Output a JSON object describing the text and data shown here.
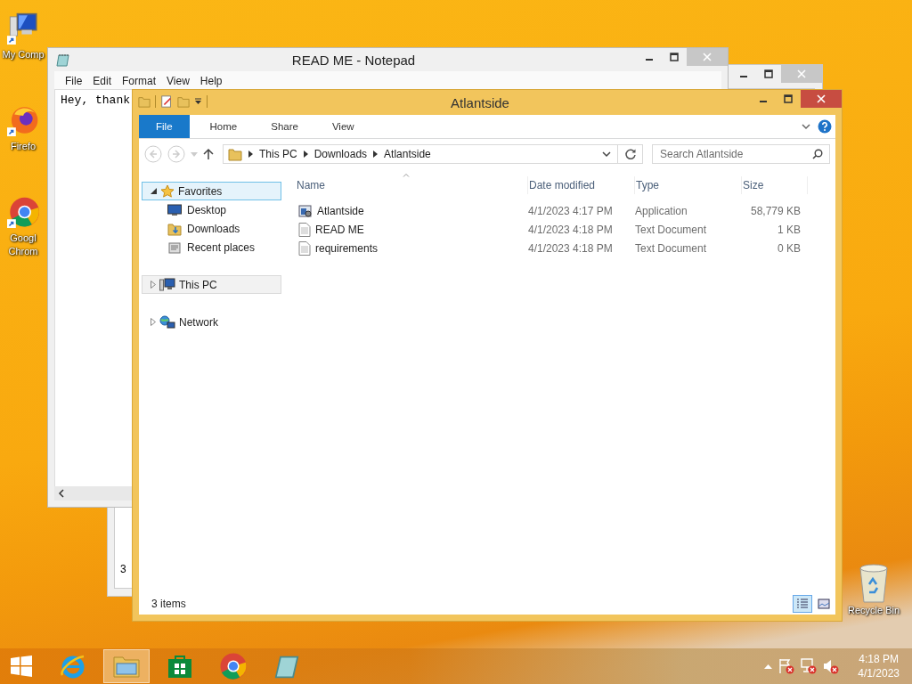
{
  "desktop_icons": [
    {
      "kind": "computer",
      "lines": [
        "My Comp"
      ]
    },
    {
      "kind": "firefox",
      "lines": [
        "Firefo"
      ]
    },
    {
      "kind": "chrome",
      "lines": [
        "Googl",
        "Chrom"
      ]
    }
  ],
  "recycle_bin": {
    "label": "Recycle Bin"
  },
  "background_window": {
    "text": "3"
  },
  "notepad": {
    "title": "READ ME - Notepad",
    "menu": [
      "File",
      "Edit",
      "Format",
      "View",
      "Help"
    ],
    "text": "Hey, thank"
  },
  "explorer": {
    "title": "Atlantside",
    "ribbon_tabs": [
      {
        "label": "File",
        "selected": true
      },
      {
        "label": "Home",
        "selected": false
      },
      {
        "label": "Share",
        "selected": false
      },
      {
        "label": "View",
        "selected": false
      }
    ],
    "breadcrumb": [
      "This PC",
      "Downloads",
      "Atlantside"
    ],
    "search": {
      "placeholder": "Search Atlantside"
    },
    "nav": [
      {
        "label": "Favorites",
        "kind": "favorites",
        "expanded": true,
        "selected": true,
        "focused": false,
        "children": [
          {
            "label": "Desktop",
            "kind": "desktop",
            "selected": false
          },
          {
            "label": "Downloads",
            "kind": "downloads",
            "selected": false
          },
          {
            "label": "Recent places",
            "kind": "recent",
            "selected": false
          }
        ]
      },
      {
        "label": "This PC",
        "kind": "pc",
        "expanded": false,
        "selected": false,
        "focused": true
      },
      {
        "label": "Network",
        "kind": "network",
        "expanded": false,
        "selected": false,
        "focused": false
      }
    ],
    "columns": [
      "Name",
      "Date modified",
      "Type",
      "Size"
    ],
    "files": [
      {
        "name": "Atlantside",
        "kind": "application",
        "date": "4/1/2023 4:17 PM",
        "type": "Application",
        "size": "58,779 KB"
      },
      {
        "name": "READ ME",
        "kind": "text",
        "date": "4/1/2023 4:18 PM",
        "type": "Text Document",
        "size": "1 KB"
      },
      {
        "name": "requirements",
        "kind": "text",
        "date": "4/1/2023 4:18 PM",
        "type": "Text Document",
        "size": "0 KB"
      }
    ],
    "status": "3 items",
    "views": [
      {
        "kind": "details",
        "selected": true
      },
      {
        "kind": "tiles",
        "selected": false
      }
    ]
  },
  "taskbar": {
    "apps": [
      {
        "kind": "ie",
        "active": false
      },
      {
        "kind": "explorer",
        "active": true
      },
      {
        "kind": "store",
        "active": false
      },
      {
        "kind": "chrome",
        "active": false
      },
      {
        "kind": "notepad",
        "active": false
      }
    ],
    "clock": {
      "time": "4:18 PM",
      "date": "4/1/2023"
    }
  }
}
